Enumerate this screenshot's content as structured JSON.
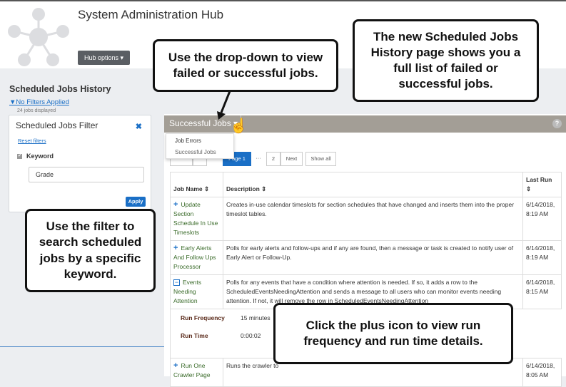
{
  "header": {
    "title": "System Administration Hub",
    "hub_options": "Hub options ▾"
  },
  "sidebar": {
    "title": "Scheduled Jobs History",
    "filter_link": "No Filters Applied",
    "count": "24 jobs displayed",
    "filter": {
      "title": "Scheduled Jobs Filter",
      "reset": "Reset filters",
      "keyword_label": "Keyword",
      "keyword_value": "Grade",
      "apply": "Apply"
    }
  },
  "main": {
    "view_selector": "Successful Jobs",
    "help": "?",
    "dropdown": [
      "Job Errors",
      "Successful Jobs"
    ],
    "pagination": {
      "page": "Page 1",
      "ellipsis": "···",
      "page2": "2",
      "next": "Next",
      "show_all": "Show all"
    },
    "columns": [
      "Job Name ⇕",
      "Description ⇕",
      "Last Run ⇕"
    ],
    "rows": [
      {
        "name": "Update Section Schedule In Use Timeslots",
        "description": "Creates in-use calendar timeslots for section schedules that have changed and inserts them into the proper timeslot tables.",
        "last_run": "6/14/2018, 8:19 AM",
        "expanded": false
      },
      {
        "name": "Early Alerts And Follow Ups Processor",
        "description": "Polls for early alerts and follow-ups and if any are found, then a message or task is created to notify user of Early Alert or Follow-Up.",
        "last_run": "6/14/2018, 8:19 AM",
        "expanded": false
      },
      {
        "name": "Events Needing Attention",
        "description": "Polls for any events that have a condition where attention is needed. If so, it adds a row to the ScheduledEventsNeedingAttention and sends a message to all users who can monitor events needing attention. If not, it will remove the row in ScheduledEventsNeedingAttention",
        "last_run": "6/14/2018, 8:15 AM",
        "expanded": true
      },
      {
        "name": "Run One Crawler Page",
        "description": "Runs the crawler to",
        "last_run": "6/14/2018, 8:05 AM",
        "expanded": false
      }
    ],
    "details": {
      "run_frequency_label": "Run Frequency",
      "run_frequency": "15 minutes",
      "run_time_label": "Run Time",
      "run_time": "0:00:02"
    }
  },
  "callouts": {
    "dropdown": "Use the drop-down to view failed or successful jobs.",
    "new_page": "The new Scheduled Jobs History page shows you a full list of failed or successful jobs.",
    "filter": "Use the filter to search scheduled jobs by a specific keyword.",
    "plus": "Click the plus icon to view run frequency and run time details."
  }
}
